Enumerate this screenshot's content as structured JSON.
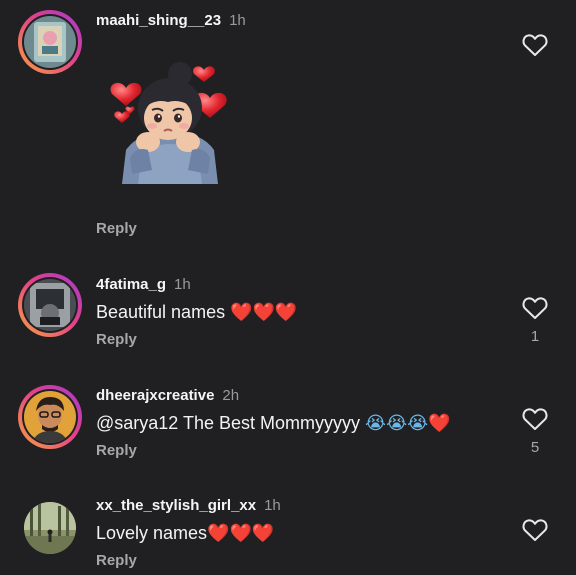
{
  "comments": [
    {
      "username": "maahi_shing__23",
      "time": "1h",
      "text": "",
      "reply_label": "Reply",
      "like_count": "",
      "sticker": "girl-with-hearts-sticker"
    },
    {
      "username": "4fatima_g",
      "time": "1h",
      "text": "Beautiful names",
      "emojis": "❤️❤️❤️",
      "reply_label": "Reply",
      "like_count": "1"
    },
    {
      "username": "dheerajxcreative",
      "time": "2h",
      "text": "@sarya12 The Best Mommyyyyy",
      "emojis": "😭😭😭❤️",
      "reply_label": "Reply",
      "like_count": "5"
    },
    {
      "username": "xx_the_stylish_girl_xx",
      "time": "1h",
      "text": "Lovely names",
      "emojis": "❤️❤️❤️",
      "reply_label": "Reply",
      "like_count": ""
    }
  ],
  "colors": {
    "background": "#202022",
    "heart_red": "#e0242f",
    "ring_gradient": [
      "#f9a33d",
      "#e4408a",
      "#a23ad0"
    ],
    "muted_text": "#a8a8a8"
  },
  "icons": {
    "like": "heart-outline-icon"
  }
}
